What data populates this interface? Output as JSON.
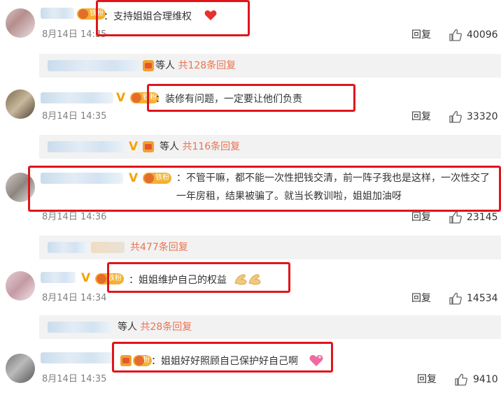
{
  "fan_badge": "铁粉",
  "reply_label": "回复",
  "others_label": "等人",
  "comments": [
    {
      "text": "：支持姐姐合理维权",
      "time": "8月14日 14:35",
      "likes": "40096",
      "sub": {
        "others": "等人",
        "count": "共128条回复"
      }
    },
    {
      "text": "：装修有问题，一定要让他们负责",
      "time": "8月14日 14:35",
      "likes": "33320",
      "sub": {
        "others": "等人",
        "count": "共116条回复"
      }
    },
    {
      "text": "：不管干嘛，都不能一次性把钱交清，前一阵子我也是这样，一次性交了一年房租，结果被骗了。就当长教训啦，姐姐加油呀",
      "time": "8月14日 14:36",
      "likes": "23145",
      "sub": {
        "others": "",
        "count": "共477条回复"
      }
    },
    {
      "text": "：姐姐维护自己的权益",
      "time": "8月14日 14:34",
      "likes": "14534",
      "sub": {
        "others": "等人",
        "count": "共28条回复"
      }
    },
    {
      "text": "：姐姐好好照顾自己保护好自己啊",
      "time": "8月14日 14:35",
      "likes": "9410"
    }
  ]
}
